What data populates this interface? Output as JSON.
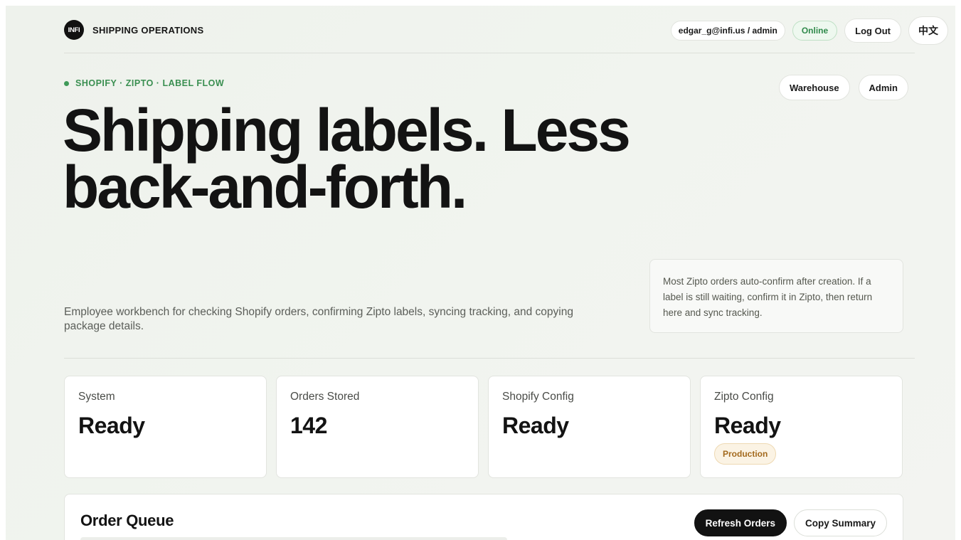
{
  "header": {
    "logo_text": "INFI",
    "brand_name": "SHIPPING OPERATIONS",
    "user": "edgar_g@infi.us / admin",
    "status": "Online",
    "logout_label": "Log Out",
    "language_label": "中文"
  },
  "hero": {
    "eyebrow": "SHOPIFY · ZIPTO · LABEL FLOW",
    "nav": {
      "warehouse_label": "Warehouse",
      "admin_label": "Admin"
    },
    "headline_line1": "Shipping labels. Less",
    "headline_line2": "back-and-forth.",
    "subtitle": "Employee workbench for checking Shopify orders, confirming Zipto labels, syncing tracking, and copying package details.",
    "note": "Most Zipto orders auto-confirm after creation. If a label is still waiting, confirm it in Zipto, then return here and sync tracking."
  },
  "stats": [
    {
      "label": "System",
      "value": "Ready"
    },
    {
      "label": "Orders Stored",
      "value": "142"
    },
    {
      "label": "Shopify Config",
      "value": "Ready"
    },
    {
      "label": "Zipto Config",
      "value": "Ready",
      "badge": "Production"
    }
  ],
  "queue": {
    "title": "Order Queue",
    "refresh_label": "Refresh Orders",
    "copy_label": "Copy Summary"
  },
  "colors": {
    "accent_green": "#3a8f51",
    "online_bg": "#eef8ef",
    "badge_text": "#a36a1e",
    "badge_bg": "#fbf3e4",
    "primary_button": "#121212"
  }
}
